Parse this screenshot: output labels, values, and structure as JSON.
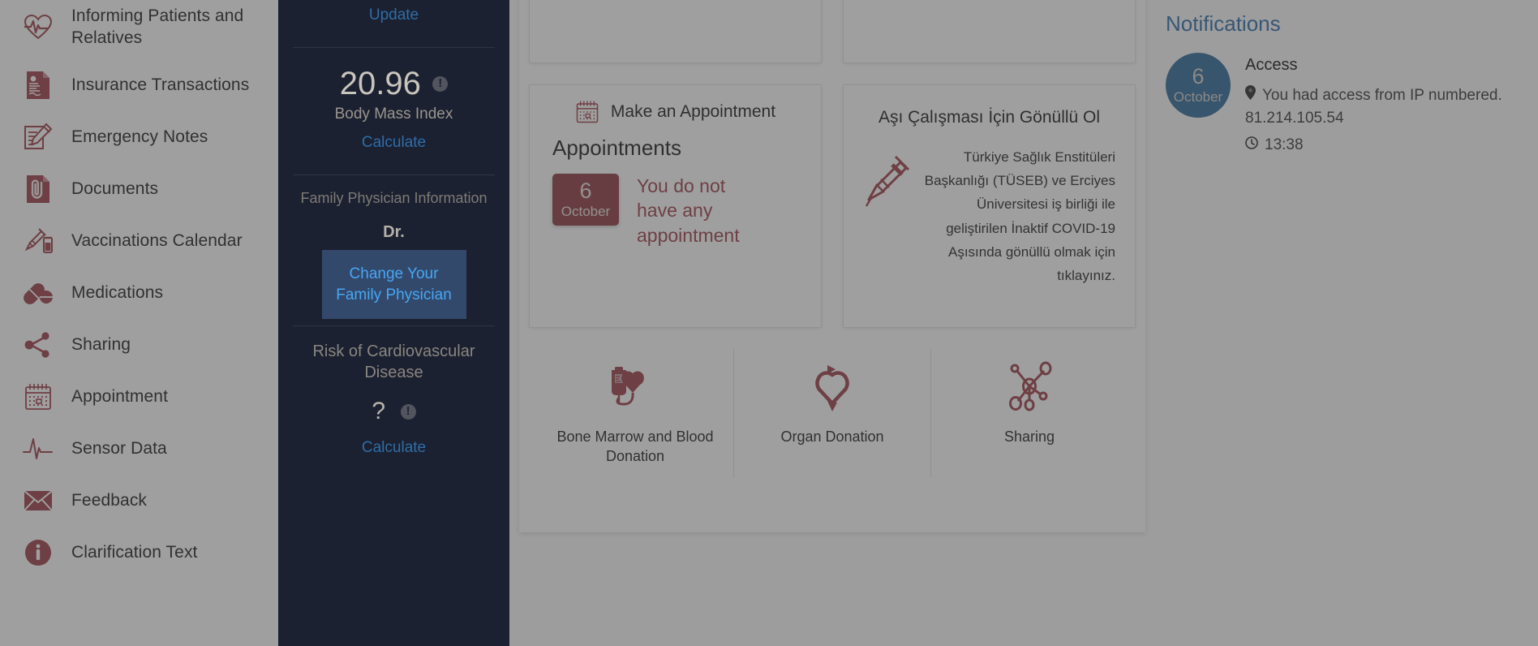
{
  "sidebar": {
    "items": [
      {
        "label": "Informing Patients and Relatives",
        "icon": "heart-pulse-icon"
      },
      {
        "label": "Insurance Transactions",
        "icon": "insurance-document-icon"
      },
      {
        "label": "Emergency Notes",
        "icon": "note-pencil-icon"
      },
      {
        "label": "Documents",
        "icon": "paperclip-document-icon"
      },
      {
        "label": "Vaccinations Calendar",
        "icon": "syringe-vial-icon"
      },
      {
        "label": "Medications",
        "icon": "pill-capsule-icon"
      },
      {
        "label": "Sharing",
        "icon": "share-nodes-icon"
      },
      {
        "label": "Appointment",
        "icon": "calendar-icon"
      },
      {
        "label": "Sensor Data",
        "icon": "heartbeat-line-icon"
      },
      {
        "label": "Feedback",
        "icon": "envelope-icon"
      },
      {
        "label": "Clarification Text",
        "icon": "info-circle-icon"
      }
    ]
  },
  "dark_panel": {
    "update_label": "Update",
    "bmi_value": "20.96",
    "bmi_label": "Body Mass Index",
    "bmi_calculate_label": "Calculate",
    "family_physician_title": "Family Physician Information",
    "doctor_name": "Dr.",
    "change_physician_label": "Change Your Family Physician",
    "risk_title": "Risk of Cardiovascular Disease",
    "risk_value": "?",
    "risk_calculate_label": "Calculate",
    "info_glyph": "!"
  },
  "main": {
    "appointment_card": {
      "header": "Make an Appointment",
      "title": "Appointments",
      "date_day": "6",
      "date_month": "October",
      "message": "You do not have any appointment"
    },
    "vaccine_card": {
      "title": "Aşı Çalışması İçin Gönüllü Ol",
      "text": "Türkiye Sağlık Enstitüleri Başkanlığı (TÜSEB) ve Erciyes Üniversitesi iş birliği ile geliştirilen İnaktif COVID-19 Aşısında gönüllü olmak için tıklayınız."
    },
    "shortcuts": [
      {
        "label": "Bone Marrow and Blood Donation",
        "icon": "blood-bag-heart-icon"
      },
      {
        "label": "Organ Donation",
        "icon": "organ-heart-arrow-icon"
      },
      {
        "label": "Sharing",
        "icon": "share-network-icon"
      }
    ]
  },
  "notifications": {
    "title": "Notifications",
    "items": [
      {
        "day": "6",
        "month": "October",
        "heading": "Access",
        "detail": "You had access from IP numbered. 81.214.105.54",
        "time": "13:38"
      }
    ]
  },
  "colors": {
    "brand_red": "#9d3f48",
    "dark_panel": "#1b2130",
    "link_blue": "#2f6da8",
    "button_blue_bg": "#33496b",
    "button_blue_text": "#46a7f5",
    "notification_circle": "#2e6b98",
    "date_badge": "#8e3b44"
  }
}
